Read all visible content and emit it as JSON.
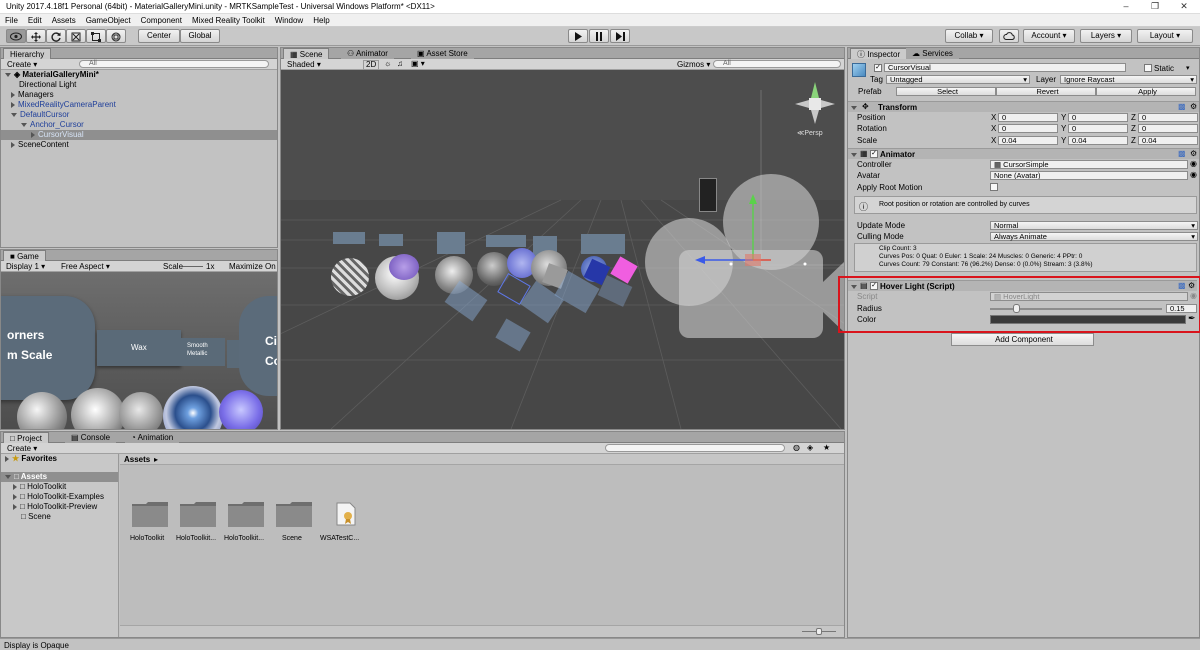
{
  "window": {
    "title": "Unity 2017.4.18f1 Personal (64bit) - MaterialGalleryMini.unity - MRTKSampleTest - Universal Windows Platform* <DX11>"
  },
  "menu": [
    "File",
    "Edit",
    "Assets",
    "GameObject",
    "Component",
    "Mixed Reality Toolkit",
    "Window",
    "Help"
  ],
  "toolbar": {
    "pivot": "Center",
    "space": "Global",
    "collab": "Collab",
    "account": "Account",
    "layers": "Layers",
    "layout": "Layout"
  },
  "hierarchy": {
    "tab": "Hierarchy",
    "create": "Create",
    "search_placeholder": "All",
    "scene": "MaterialGalleryMini*",
    "items": [
      "Directional Light",
      "Managers",
      "MixedRealityCameraParent",
      "DefaultCursor",
      "Anchor_Cursor",
      "CursorVisual",
      "SceneContent"
    ]
  },
  "scene_view": {
    "tabs": [
      "Scene",
      "Animator",
      "Asset Store"
    ],
    "shading": "Shaded",
    "mode_2d": "2D",
    "gizmos": "Gizmos",
    "search_placeholder": "All",
    "persp": "Persp"
  },
  "game_view": {
    "tab": "Game",
    "display": "Display 1",
    "aspect": "Free Aspect",
    "scale_label": "Scale",
    "scale_value": "1x",
    "maximize": "Maximize On Pl",
    "card_left_1": "orners",
    "card_left_2": "m Scale",
    "card_wax": "Wax",
    "card_smooth_1": "Smooth",
    "card_smooth_2": "Metallic",
    "card_right_1": "Ci",
    "card_right_2": "Co"
  },
  "inspector": {
    "tabs": [
      "Inspector",
      "Services"
    ],
    "object_name": "CursorVisual",
    "static_label": "Static",
    "tag_label": "Tag",
    "tag_value": "Untagged",
    "layer_label": "Layer",
    "layer_value": "Ignore Raycast",
    "prefab_label": "Prefab",
    "prefab_select": "Select",
    "prefab_revert": "Revert",
    "prefab_apply": "Apply",
    "transform": {
      "title": "Transform",
      "position_label": "Position",
      "rotation_label": "Rotation",
      "scale_label": "Scale",
      "position": [
        "0",
        "0",
        "0"
      ],
      "rotation": [
        "0",
        "0",
        "0"
      ],
      "scale": [
        "0.04",
        "0.04",
        "0.04"
      ]
    },
    "animator": {
      "title": "Animator",
      "controller_label": "Controller",
      "controller_value": "CursorSimple",
      "avatar_label": "Avatar",
      "avatar_value": "None (Avatar)",
      "root_motion_label": "Apply Root Motion",
      "info": "Root position or rotation are controlled by curves",
      "update_mode_label": "Update Mode",
      "update_mode_value": "Normal",
      "culling_mode_label": "Culling Mode",
      "culling_mode_value": "Always Animate",
      "stats_1": "Clip Count: 3",
      "stats_2": "Curves Pos: 0 Quat: 0 Euler: 1 Scale: 24 Muscles: 0 Generic: 4 PPtr: 0",
      "stats_3": "Curves Count: 79 Constant: 76 (96.2%) Dense: 0 (0.0%) Stream: 3 (3.8%)"
    },
    "hover_light": {
      "title": "Hover Light (Script)",
      "script_label": "Script",
      "script_value": "HoverLight",
      "radius_label": "Radius",
      "radius_value": "0.15",
      "color_label": "Color",
      "color_hex": "#3a3a3a"
    },
    "add_component": "Add Component"
  },
  "project": {
    "tabs": [
      "Project",
      "Console",
      "Animation"
    ],
    "create": "Create",
    "favorites": "Favorites",
    "tree_assets": "Assets",
    "tree_items": [
      "HoloToolkit",
      "HoloToolkit-Examples",
      "HoloToolkit-Preview",
      "Scene"
    ],
    "breadcrumb": "Assets",
    "assets": [
      "HoloToolkit",
      "HoloToolkit...",
      "HoloToolkit...",
      "Scene",
      "WSATestC..."
    ]
  },
  "status": "Display is Opaque",
  "colors": {
    "highlight": "#d9141c",
    "selection": "#8f8f8f"
  }
}
